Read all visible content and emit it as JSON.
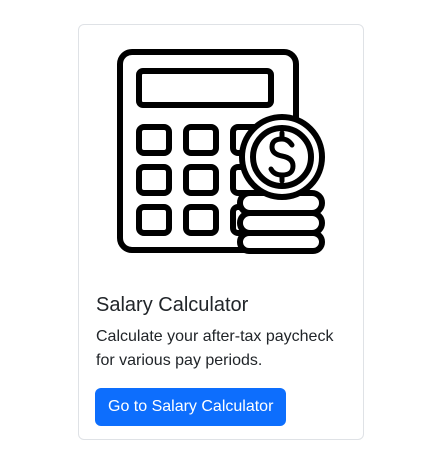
{
  "card": {
    "image": {
      "icon": "calculator-with-dollar-coins-icon"
    },
    "title": "Salary Calculator",
    "description": "Calculate your after-tax paycheck for various pay periods.",
    "button_label": "Go to Salary Calculator"
  },
  "colors": {
    "accent": "#0d6efd",
    "text": "#212529",
    "border": "#dfe2e6",
    "icon": "#000000"
  }
}
